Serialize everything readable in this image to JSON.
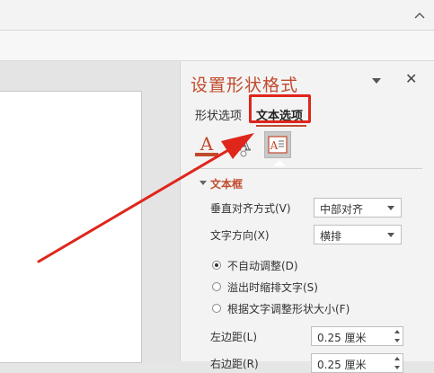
{
  "ribbon": {
    "collapse_icon": "chevron-up-icon"
  },
  "pane": {
    "title": "设置形状格式",
    "close_icon": "close-icon",
    "dropdown_icon": "triangle-down-icon",
    "tabs": [
      {
        "label": "形状选项",
        "active": false
      },
      {
        "label": "文本选项",
        "active": true
      }
    ],
    "icons": [
      {
        "name": "text-fill-outline-icon",
        "glyph": "A"
      },
      {
        "name": "text-effects-icon",
        "glyph": "A"
      },
      {
        "name": "textbox-icon",
        "glyph": "A≡"
      }
    ],
    "section": {
      "title": "文本框",
      "vertical_align": {
        "label": "垂直对齐方式(V)",
        "value": "中部对齐"
      },
      "text_direction": {
        "label": "文字方向(X)",
        "value": "横排"
      },
      "autofit_options": [
        {
          "label": "不自动调整(D)",
          "checked": true
        },
        {
          "label": "溢出时缩排文字(S)",
          "checked": false
        },
        {
          "label": "根据文字调整形状大小(F)",
          "checked": false
        }
      ],
      "left_margin": {
        "label": "左边距(L)",
        "value": "0.25 厘米"
      },
      "right_margin": {
        "label": "右边距(R)",
        "value": "0.25 厘米"
      }
    }
  },
  "annotation": {
    "color": "#e0251b"
  },
  "colors": {
    "accent": "#c14a2c",
    "highlight": "#e0251b"
  }
}
